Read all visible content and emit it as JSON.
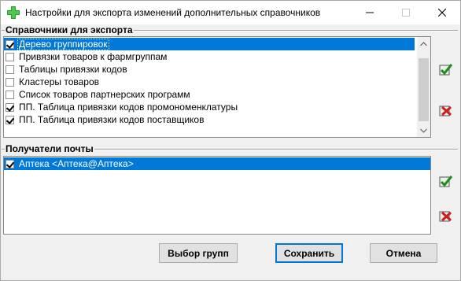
{
  "window": {
    "title": "Настройки для экспорта изменений дополнительных справочников"
  },
  "reference_group": {
    "label": "Справочники  для экспорта",
    "items": [
      {
        "label": "Дерево группировок",
        "checked": true,
        "selected": true
      },
      {
        "label": "Привязки товаров к фармгруппам",
        "checked": false,
        "selected": false
      },
      {
        "label": "Таблицы привязки кодов",
        "checked": false,
        "selected": false
      },
      {
        "label": "Кластеры товаров",
        "checked": false,
        "selected": false
      },
      {
        "label": "Список товаров партнерских программ",
        "checked": false,
        "selected": false
      },
      {
        "label": "ПП. Таблица привязки кодов промономенклатуры",
        "checked": true,
        "selected": false
      },
      {
        "label": "ПП. Таблица привязки кодов поставщиков",
        "checked": true,
        "selected": false
      }
    ],
    "scroll_position": 0.15
  },
  "recipients_group": {
    "label": "Получатели почты",
    "items": [
      {
        "label": "Аптека <Аптека@Аптека>",
        "checked": true,
        "selected": true
      }
    ]
  },
  "buttons": {
    "select_groups": "Выбор групп",
    "save": "Сохранить",
    "cancel": "Отмена"
  },
  "icons": {
    "app": "green-cross-icon",
    "check_all": "check-all-icon",
    "uncheck_all": "uncheck-all-icon"
  },
  "colors": {
    "selection": "#0078d7",
    "check_green": "#1e8c1e",
    "cross_red": "#c81e1e"
  }
}
